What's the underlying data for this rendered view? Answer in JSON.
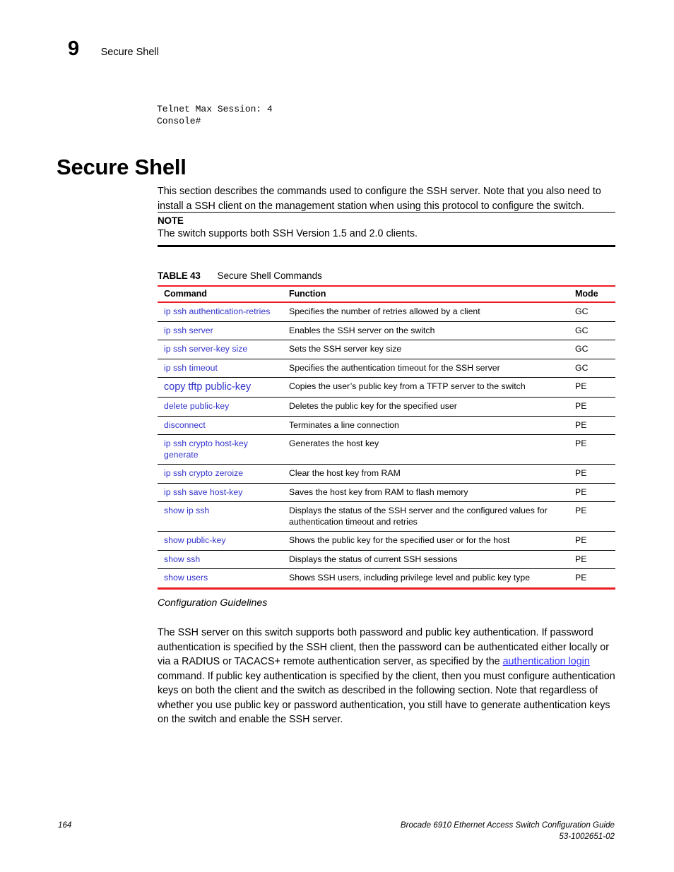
{
  "running_head": {
    "chapter_number": "9",
    "title": "Secure Shell"
  },
  "cli_output": "Telnet Max Session: 4\nConsole#",
  "section": {
    "heading": "Secure Shell",
    "intro": "This section describes the commands used to configure the SSH server. Note that you also need to install a SSH client on the management station when using this protocol to configure the switch."
  },
  "note": {
    "label": "NOTE",
    "text": "The switch supports both SSH Version 1.5 and 2.0 clients."
  },
  "table": {
    "number": "TABLE 43",
    "title": "Secure Shell Commands",
    "columns": [
      "Command",
      "Function",
      "Mode"
    ],
    "rows": [
      {
        "command": "ip ssh authentication-retries",
        "function": "Specifies the number of retries allowed by a client",
        "mode": "GC",
        "emphasis": false
      },
      {
        "command": "ip ssh server",
        "function": "Enables the SSH server on the switch",
        "mode": "GC",
        "emphasis": false
      },
      {
        "command": "ip ssh server-key size",
        "function": "Sets the SSH server key size",
        "mode": "GC",
        "emphasis": false
      },
      {
        "command": "ip ssh timeout",
        "function": "Specifies the authentication timeout for the SSH server",
        "mode": "GC",
        "emphasis": false
      },
      {
        "command": "copy tftp public-key",
        "function": "Copies the user’s public key from a TFTP server to the switch",
        "mode": "PE",
        "emphasis": true
      },
      {
        "command": "delete public-key",
        "function": "Deletes the public key for the specified user",
        "mode": "PE",
        "emphasis": false
      },
      {
        "command": "disconnect",
        "function": "Terminates a line connection",
        "mode": "PE",
        "emphasis": false
      },
      {
        "command": "ip ssh crypto host-key generate",
        "function": "Generates the host key",
        "mode": "PE",
        "emphasis": false
      },
      {
        "command": "ip ssh crypto zeroize",
        "function": "Clear the host key from RAM",
        "mode": "PE",
        "emphasis": false
      },
      {
        "command": "ip ssh save host-key",
        "function": "Saves the host key from RAM to flash memory",
        "mode": "PE",
        "emphasis": false
      },
      {
        "command": "show ip ssh",
        "function": "Displays the status of the SSH server and the configured values for authentication timeout and retries",
        "mode": "PE",
        "emphasis": false
      },
      {
        "command": "show public-key",
        "function": "Shows the public key for the specified user or for the host",
        "mode": "PE",
        "emphasis": false
      },
      {
        "command": "show ssh",
        "function": "Displays the status of current SSH sessions",
        "mode": "PE",
        "emphasis": false
      },
      {
        "command": "show users",
        "function": "Shows SSH users, including privilege level and public key type",
        "mode": "PE",
        "emphasis": false
      }
    ]
  },
  "guidelines": {
    "heading": "Configuration Guidelines",
    "part1": "The SSH server on this switch supports both password and public key authentication. If password authentication is specified by the SSH client, then the password can be authenticated either locally or via a RADIUS or TACACS+ remote authentication server, as specified by the ",
    "link": "authentication login",
    "part2": " command. If public key authentication is specified by the client, then you must configure authentication keys on both the client and the switch as described in the following section. Note that regardless of whether you use public key or password authentication, you still have to generate authentication keys on the switch and enable the SSH server."
  },
  "footer": {
    "page_number": "164",
    "guide_title": "Brocade 6910 Ethernet Access Switch Configuration Guide",
    "document_number": "53-1002651-02"
  },
  "colors": {
    "rule_red": "#ed1c24",
    "command_link": "#3333cc",
    "inline_link": "#3333ff",
    "text": "#000000"
  }
}
